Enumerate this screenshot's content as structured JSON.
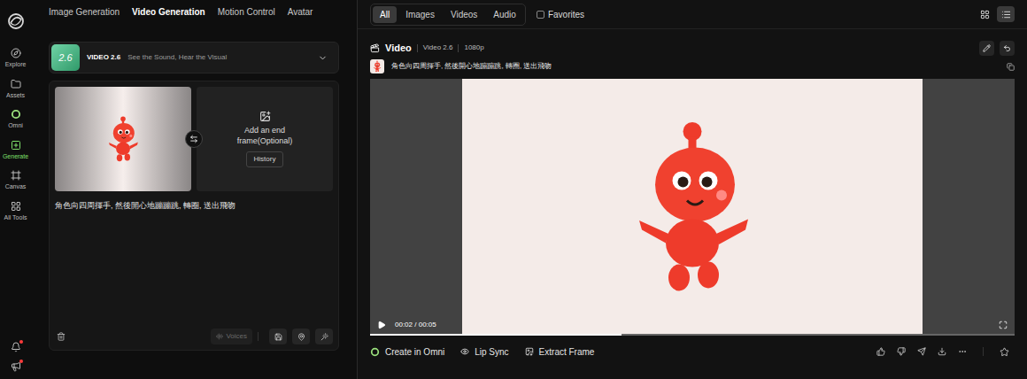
{
  "sidebar": {
    "items": [
      {
        "label": "Explore",
        "selected": false
      },
      {
        "label": "Assets",
        "selected": false
      },
      {
        "label": "Omni",
        "selected": false
      },
      {
        "label": "Generate",
        "selected": true
      },
      {
        "label": "Canvas",
        "selected": false
      },
      {
        "label": "All Tools",
        "selected": false
      }
    ],
    "bottom_icons": [
      {
        "badge": true
      },
      {
        "badge": true
      }
    ]
  },
  "top_tabs": [
    {
      "label": "Image Generation",
      "selected": false
    },
    {
      "label": "Video Generation",
      "selected": true
    },
    {
      "label": "Motion Control",
      "selected": false
    },
    {
      "label": "Avatar",
      "selected": false
    }
  ],
  "model": {
    "thumb_label": "2.6",
    "name": "VIDEO 2.6",
    "tagline": "See the Sound, Hear the Visual"
  },
  "end_frame": {
    "label": "Add an end frame(Optional)",
    "button": "History"
  },
  "prompt": "角色向四周揮手, 然後開心地蹦蹦跳, 轉圈, 送出飛吻",
  "voices_button": {
    "label": "Voices",
    "disabled": true
  },
  "filters": [
    {
      "label": "All",
      "selected": true
    },
    {
      "label": "Images",
      "selected": false
    },
    {
      "label": "Videos",
      "selected": false
    },
    {
      "label": "Audio",
      "selected": false
    }
  ],
  "favorites": {
    "label": "Favorites",
    "checked": false
  },
  "view_modes": [
    {
      "kind": "grid",
      "selected": false
    },
    {
      "kind": "list",
      "selected": true
    }
  ],
  "result": {
    "type": "Video",
    "model": "Video 2.6",
    "resolution": "1080p",
    "prompt": "角色向四周揮手, 然後開心地蹦蹦跳, 轉圈, 送出飛吻",
    "player": {
      "time": "00:02 / 00:05",
      "level": 0.39,
      "playing": false
    }
  },
  "actions": [
    "Create in Omni",
    "Lip Sync",
    "Extract Frame"
  ]
}
